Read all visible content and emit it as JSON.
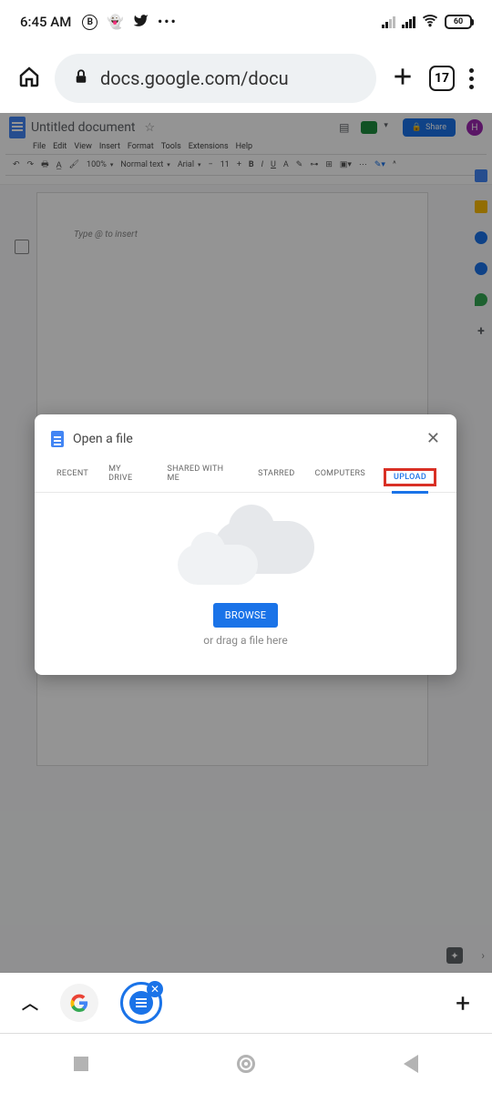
{
  "status": {
    "time": "6:45 AM",
    "b_icon": "B",
    "battery": "60"
  },
  "browser": {
    "url": "docs.google.com/docu",
    "tab_count": "17"
  },
  "docs": {
    "title": "Untitled document",
    "menu": [
      "File",
      "Edit",
      "View",
      "Insert",
      "Format",
      "Tools",
      "Extensions",
      "Help"
    ],
    "toolbar": {
      "zoom": "100%",
      "style": "Normal text",
      "font": "Arial",
      "size": "11"
    },
    "share_label": "Share",
    "avatar_letter": "H",
    "placeholder": "Type @ to insert"
  },
  "modal": {
    "title": "Open a file",
    "tabs": {
      "recent": "RECENT",
      "mydrive": "MY DRIVE",
      "shared": "SHARED WITH ME",
      "starred": "STARRED",
      "computers": "COMPUTERS",
      "upload": "UPLOAD"
    },
    "browse": "BROWSE",
    "drag_text": "or drag a file here"
  },
  "appbar": {
    "plus": "+"
  }
}
